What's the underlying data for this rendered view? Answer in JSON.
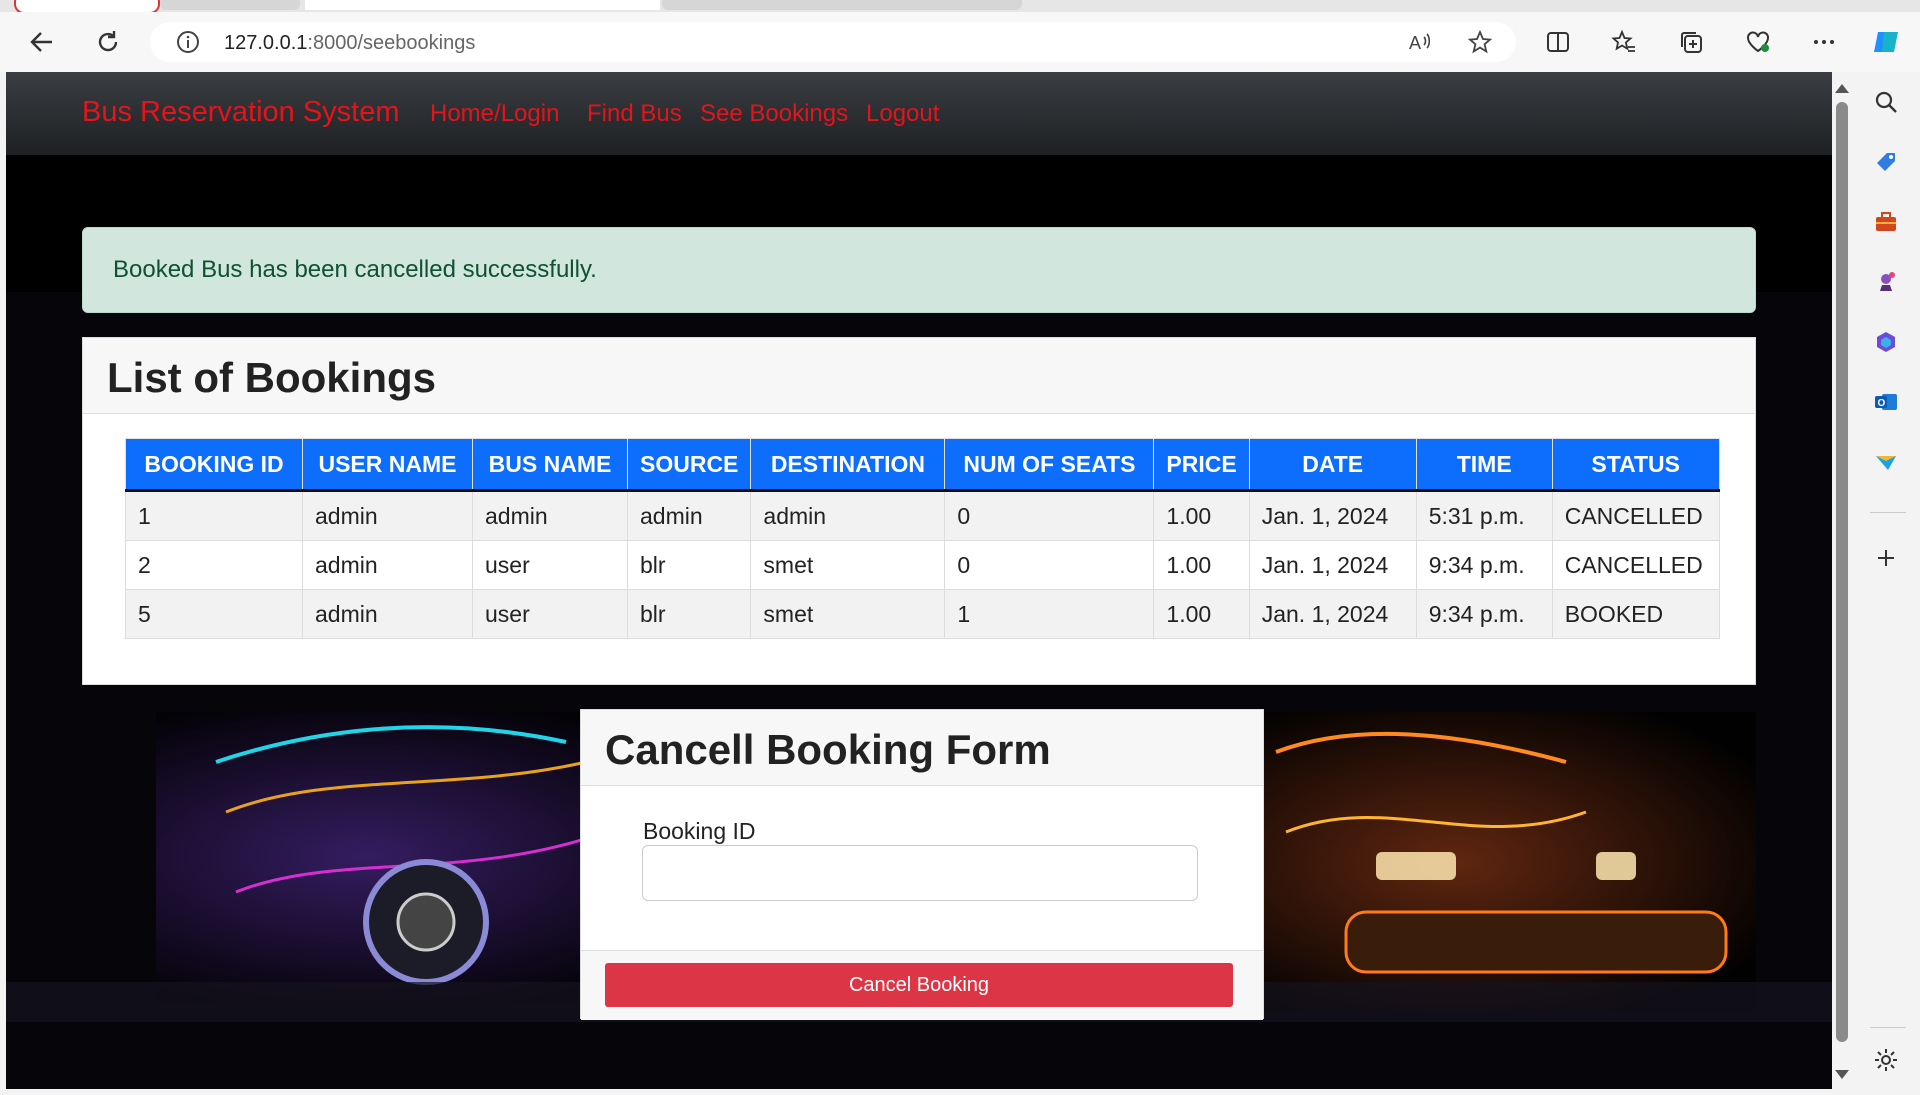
{
  "browser": {
    "url_host": "127.0.0.1",
    "url_path": ":8000/seebookings"
  },
  "navbar": {
    "brand": "Bus Reservation System",
    "links": [
      "Home/Login",
      "Find Bus",
      "See Bookings",
      "Logout"
    ]
  },
  "alert": {
    "message": "Booked Bus has been cancelled successfully."
  },
  "bookings": {
    "title": "List of Bookings",
    "columns": [
      "BOOKING ID",
      "USER NAME",
      "BUS NAME",
      "SOURCE",
      "DESTINATION",
      "NUM OF SEATS",
      "PRICE",
      "DATE",
      "TIME",
      "STATUS"
    ],
    "rows": [
      [
        "1",
        "admin",
        "admin",
        "admin",
        "admin",
        "0",
        "1.00",
        "Jan. 1, 2024",
        "5:31 p.m.",
        "CANCELLED"
      ],
      [
        "2",
        "admin",
        "user",
        "blr",
        "smet",
        "0",
        "1.00",
        "Jan. 1, 2024",
        "9:34 p.m.",
        "CANCELLED"
      ],
      [
        "5",
        "admin",
        "user",
        "blr",
        "smet",
        "1",
        "1.00",
        "Jan. 1, 2024",
        "9:34 p.m.",
        "BOOKED"
      ]
    ]
  },
  "cancel_form": {
    "title": "Cancell Booking Form",
    "field_label": "Booking ID",
    "field_value": "",
    "submit_label": "Cancel Booking"
  },
  "colors": {
    "brand_red": "#e4141b",
    "table_header": "#0d6efd",
    "alert_bg": "#d1e7dd",
    "danger": "#dc3545"
  },
  "icons": {
    "toolbar": [
      "back-arrow-icon",
      "refresh-icon",
      "info-icon",
      "read-aloud-icon",
      "favorite-star-icon",
      "split-screen-icon",
      "favorites-icon",
      "collections-icon",
      "browser-essentials-icon",
      "more-icon",
      "copilot-icon"
    ],
    "sidebar": [
      "search-icon",
      "shopping-tag-icon",
      "tools-icon",
      "games-icon",
      "microsoft365-icon",
      "outlook-icon",
      "drop-icon",
      "add-icon",
      "settings-icon"
    ]
  }
}
